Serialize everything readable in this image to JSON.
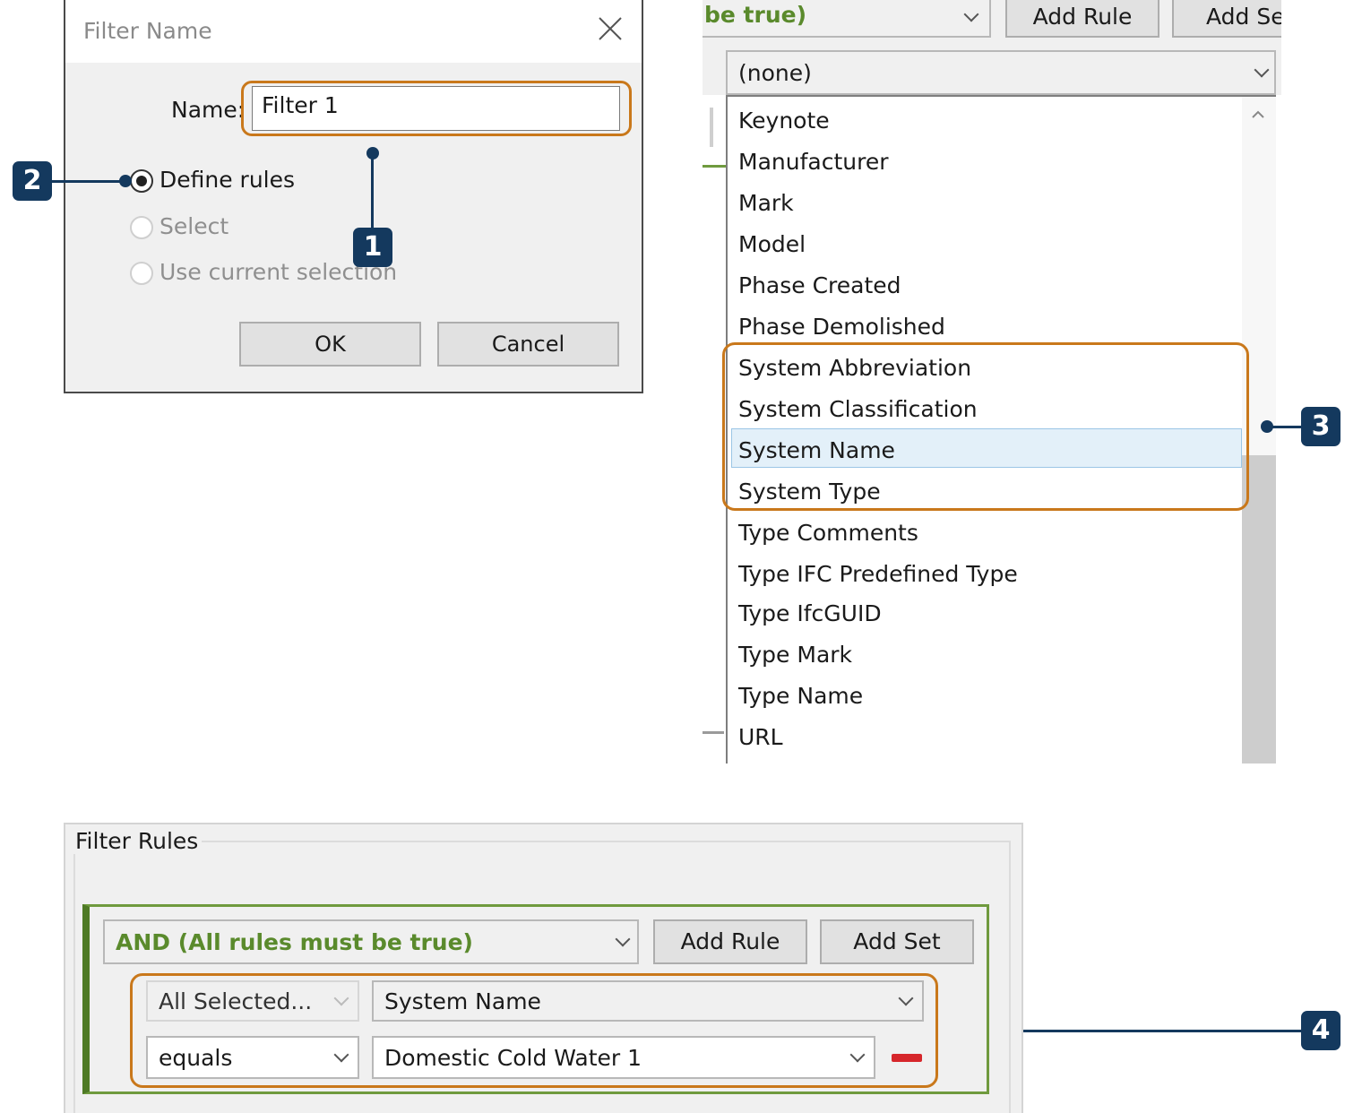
{
  "dialog": {
    "title": "Filter Name",
    "name_label": "Name:",
    "name_value": "Filter 1",
    "radios": [
      {
        "label": "Define rules",
        "checked": true,
        "enabled": true
      },
      {
        "label": "Select",
        "checked": false,
        "enabled": false
      },
      {
        "label": "Use current selection",
        "checked": false,
        "enabled": false
      }
    ],
    "ok_label": "OK",
    "cancel_label": "Cancel"
  },
  "panel": {
    "top_combo_text": "be true)",
    "add_rule_label": "Add Rule",
    "add_set_label": "Add Se",
    "selected_value": "(none)",
    "items": [
      "Keynote",
      "Manufacturer",
      "Mark",
      "Model",
      "Phase Created",
      "Phase Demolished",
      "System Abbreviation",
      "System Classification",
      "System Name",
      "System Type",
      "Type Comments",
      "Type IFC Predefined Type",
      "Type IfcGUID",
      "Type Mark",
      "Type Name",
      "URL"
    ],
    "highlighted_item": "System Name"
  },
  "callouts": [
    "1",
    "2",
    "3",
    "4"
  ],
  "rules": {
    "legend": "Filter Rules",
    "logic": "AND (All rules must be true)",
    "add_rule_label": "Add Rule",
    "add_set_label": "Add Set",
    "category": "All Selected...",
    "parameter": "System Name",
    "operator": "equals",
    "value": "Domestic Cold Water 1"
  },
  "colors": {
    "highlight_orange": "#c9781b",
    "callout_navy": "#14395e",
    "set_green": "#5a8a2c",
    "remove_red": "#d6262b",
    "selection_blue": "#e3f0f9"
  }
}
